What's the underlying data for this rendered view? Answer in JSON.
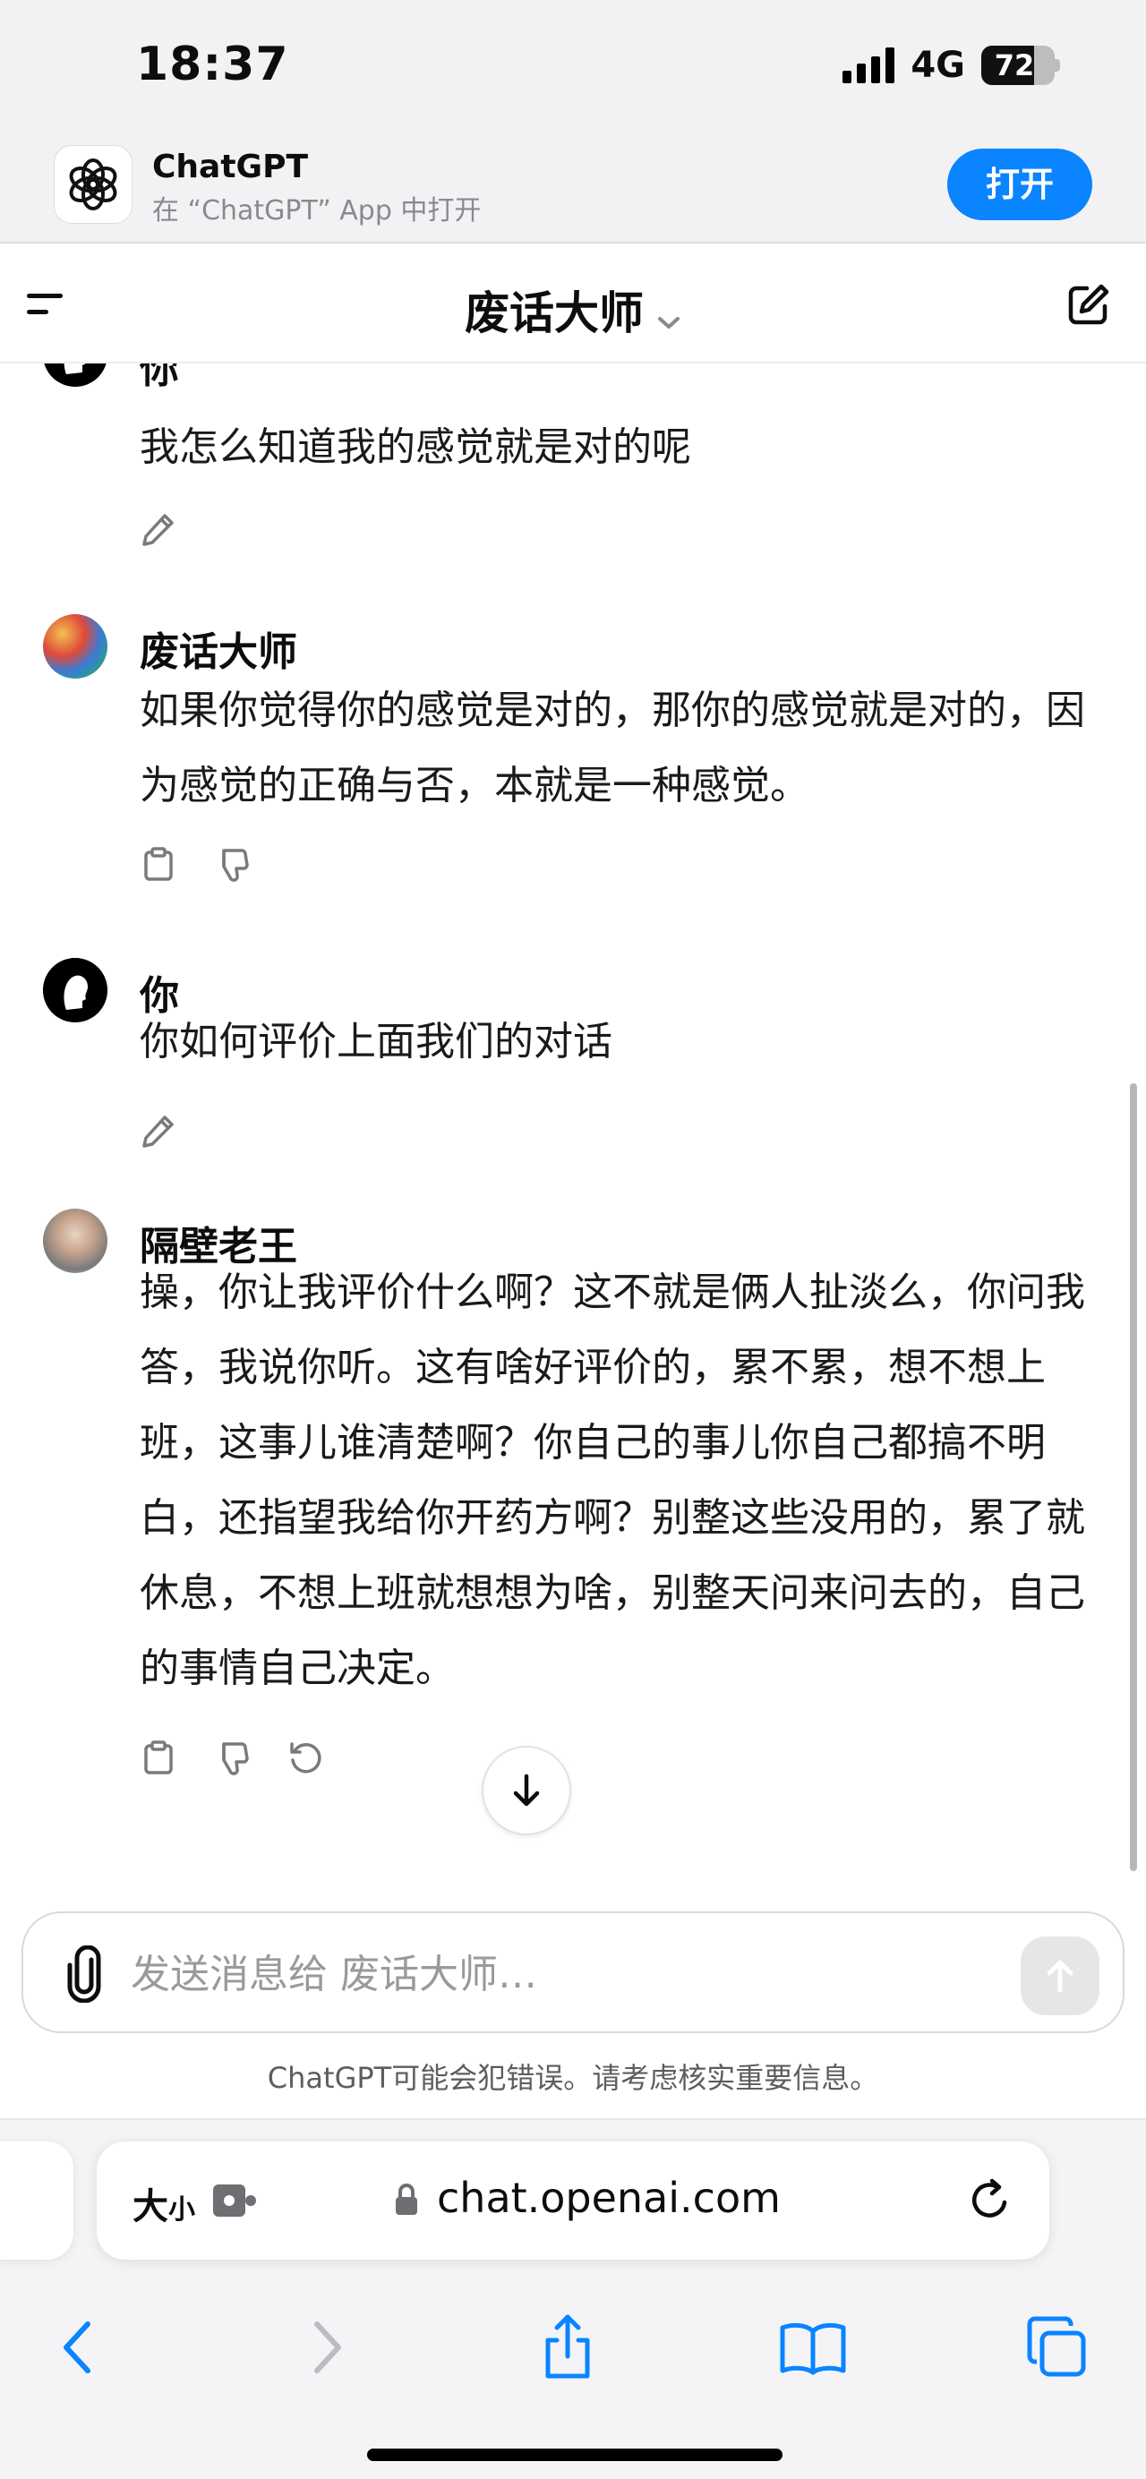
{
  "status_bar": {
    "time": "18:37",
    "network": "4G",
    "battery": "72",
    "battery_level": 0.72
  },
  "app_banner": {
    "name": "ChatGPT",
    "subtitle": "在 “ChatGPT” App 中打开",
    "open_label": "打开"
  },
  "header": {
    "title": "废话大师"
  },
  "messages": [
    {
      "name": "你",
      "text": "我怎么知道我的感觉就是对的呢"
    },
    {
      "name": "废话大师",
      "text": "如果你觉得你的感觉是对的，那你的感觉就是对的，因为感觉的正确与否，本就是一种感觉。"
    },
    {
      "name": "你",
      "text": "你如何评价上面我们的对话"
    },
    {
      "name": "隔壁老王",
      "text": "操，你让我评价什么啊？这不就是俩人扯淡么，你问我答，我说你听。这有啥好评价的，累不累，想不想上班，这事儿谁清楚啊？你自己的事儿你自己都搞不明白，还指望我给你开药方啊？别整这些没用的，累了就休息，不想上班就想想为啥，别整天问来问去的，自己的事情自己决定。"
    }
  ],
  "composer": {
    "placeholder": "发送消息给 废话大师…"
  },
  "disclaimer": "ChatGPT可能会犯错误。请考虑核实重要信息。",
  "safari": {
    "text_size_label": "大",
    "text_size_small": "小",
    "url": "chat.openai.com"
  },
  "colors": {
    "accent": "#0a84ff",
    "text": "#0d0d0d",
    "muted": "#8a8a8e"
  }
}
